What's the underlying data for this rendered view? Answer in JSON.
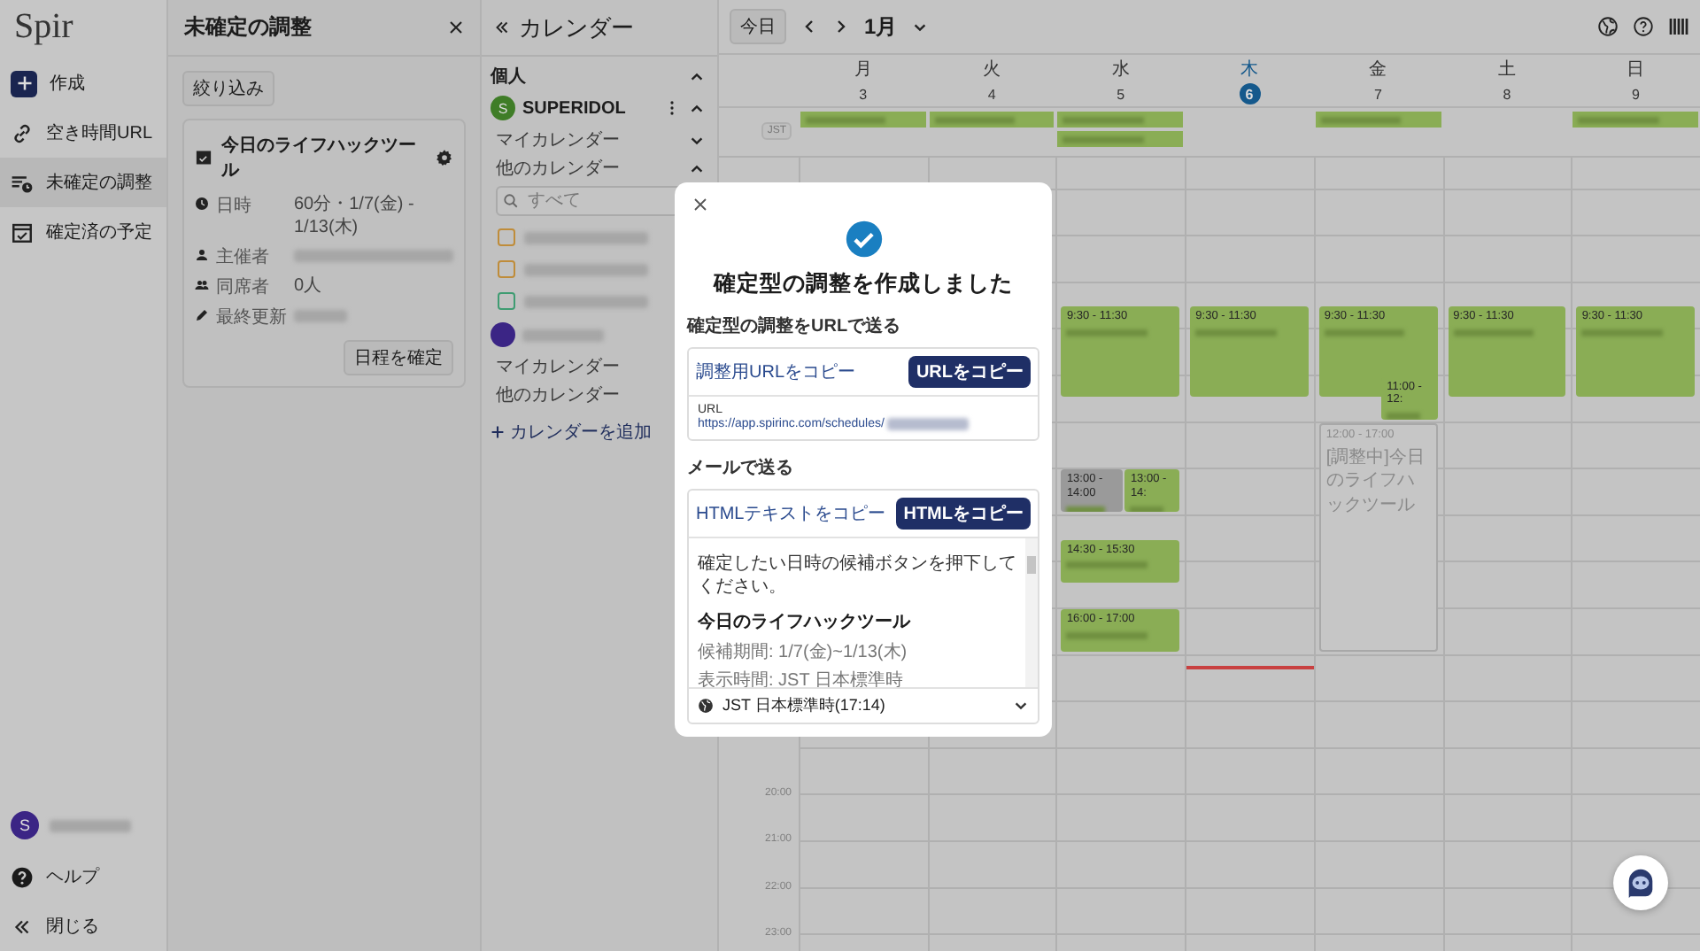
{
  "nav": {
    "logo": "Spir",
    "items": [
      {
        "label": "作成",
        "kind": "create",
        "selected": false
      },
      {
        "label": "空き時間URL",
        "kind": "link",
        "selected": false
      },
      {
        "label": "未確定の調整",
        "kind": "pending",
        "selected": true
      },
      {
        "label": "確定済の予定",
        "kind": "confirmed",
        "selected": false
      }
    ],
    "user": {
      "initial": "S"
    },
    "bottom": [
      {
        "label": "ヘルプ",
        "kind": "help"
      },
      {
        "label": "閉じる",
        "kind": "collapse"
      }
    ]
  },
  "pending_panel": {
    "title": "未確定の調整",
    "filter_button": "絞り込み",
    "card": {
      "title": "今日のライフハックツール",
      "rows": [
        {
          "kind": "time",
          "label": "日時",
          "value": "60分・1/7(金) - 1/13(木)"
        },
        {
          "kind": "organizer",
          "label": "主催者"
        },
        {
          "kind": "attendees",
          "label": "同席者",
          "value": "0人"
        },
        {
          "kind": "updated",
          "label": "最終更新"
        }
      ],
      "confirm_button": "日程を確定"
    }
  },
  "calendar_sidebar": {
    "title": "カレンダー",
    "section": "個人",
    "section_expanded": true,
    "search_placeholder": "すべて",
    "add_link": "カレンダーを追加",
    "accounts": [
      {
        "name": "SUPERIDOL",
        "initial": "S",
        "color": "#3f7d27",
        "expanded": true,
        "groups": [
          {
            "label": "マイカレンダー",
            "expanded": false
          },
          {
            "label": "他のカレンダー",
            "expanded": true
          }
        ],
        "calendars": [
          {
            "color": "#bf8c3a",
            "checked": false
          },
          {
            "color": "#bf8c3a",
            "checked": false
          },
          {
            "color": "#3f9c72",
            "checked": false
          }
        ]
      },
      {
        "color": "#3b2585",
        "groups": [
          {
            "label": "マイカレンダー"
          },
          {
            "label": "他のカレンダー"
          }
        ]
      }
    ]
  },
  "calendar": {
    "today_button": "今日",
    "month": "1月",
    "timezone": "JST",
    "time_labels": [
      "20:00",
      "21:00",
      "22:00",
      "23:00"
    ],
    "days": [
      {
        "weekday": "月",
        "date": "3",
        "today": false,
        "all_day": [
          {
            "kind": "event"
          }
        ]
      },
      {
        "weekday": "火",
        "date": "4",
        "today": false,
        "all_day": [
          {
            "kind": "event"
          }
        ]
      },
      {
        "weekday": "水",
        "date": "5",
        "today": false,
        "all_day": [
          {
            "kind": "event"
          },
          {
            "kind": "event"
          }
        ],
        "events": [
          {
            "kind": "event",
            "color": "#8aad55",
            "time": "9:30 - 11:30"
          },
          {
            "kind": "event",
            "color": "#9a9a9a",
            "time": "13:00 - 14:00"
          },
          {
            "kind": "event",
            "color": "#8aad55",
            "time": "13:00 - 14:"
          },
          {
            "kind": "event",
            "color": "#8aad55",
            "time": "14:30 - 15:30"
          },
          {
            "kind": "event",
            "color": "#8aad55",
            "time": "16:00 - 17:00"
          }
        ]
      },
      {
        "weekday": "木",
        "date": "6",
        "today": true,
        "events": [
          {
            "kind": "event",
            "color": "#8aad55",
            "time": "9:30 - 11:30"
          }
        ]
      },
      {
        "weekday": "金",
        "date": "7",
        "today": false,
        "all_day": [
          {
            "kind": "event"
          }
        ],
        "events": [
          {
            "kind": "event",
            "color": "#8aad55",
            "time": "9:30 - 11:30"
          },
          {
            "kind": "event",
            "color": "#8aad55",
            "time": "11:00 - 12:"
          },
          {
            "kind": "pending",
            "time": "12:00 - 17:00",
            "title": "[調整中]今日のライフハックツール"
          }
        ]
      },
      {
        "weekday": "土",
        "date": "8",
        "today": false,
        "events": [
          {
            "kind": "event",
            "color": "#8aad55",
            "time": "9:30 - 11:30"
          }
        ]
      },
      {
        "weekday": "日",
        "date": "9",
        "today": false,
        "all_day": [
          {
            "kind": "event"
          }
        ],
        "events": [
          {
            "kind": "event",
            "color": "#8aad55",
            "time": "9:30 - 11:30"
          }
        ]
      }
    ]
  },
  "dialog": {
    "title": "確定型の調整を作成しました",
    "url_section": {
      "heading": "確定型の調整をURLで送る",
      "copy_label": "調整用URLをコピー",
      "copy_button": "URLをコピー",
      "url_label": "URL",
      "url": "https://app.spirinc.com/schedules/"
    },
    "mail_section": {
      "heading": "メールで送る",
      "copy_label": "HTMLテキストをコピー",
      "copy_button": "HTMLをコピー",
      "preview": [
        {
          "kind": "rule"
        },
        {
          "kind": "text",
          "text": "確定したい日時の候補ボタンを押下してください。"
        },
        {
          "kind": "title",
          "text": "今日のライフハックツール"
        },
        {
          "kind": "meta",
          "text": "候補期間: 1/7(金)~1/13(木)"
        },
        {
          "kind": "meta",
          "text": "表示時間: JST 日本標準時"
        }
      ]
    },
    "timezone": "JST 日本標準時(17:14)"
  }
}
